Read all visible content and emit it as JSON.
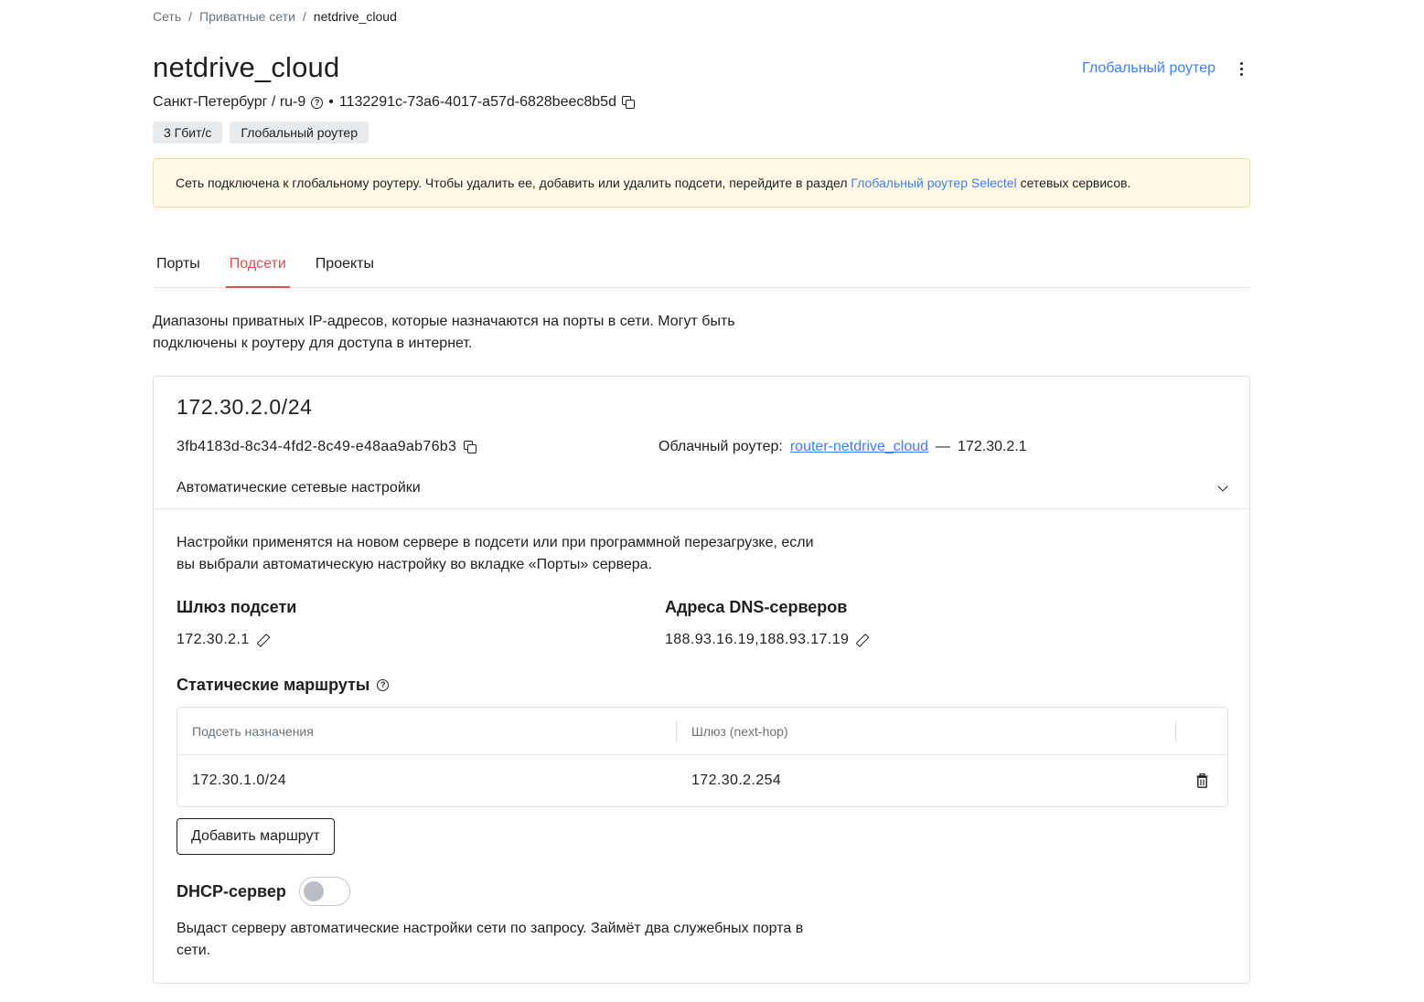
{
  "breadcrumb": {
    "items": [
      "Сеть",
      "Приватные сети"
    ],
    "separator": "/",
    "current": "netdrive_cloud"
  },
  "header": {
    "title": "netdrive_cloud",
    "location": "Санкт-Петербург / ru-9",
    "bullet": "•",
    "network_id": "1132291c-73a6-4017-a57d-6828beec8b5d",
    "global_router_link": "Глобальный роутер",
    "tags": [
      "3 Гбит/с",
      "Глобальный роутер"
    ]
  },
  "alert": {
    "text_before": "Сеть подключена к глобальному роутеру. Чтобы удалить ее, добавить или удалить подсети, перейдите в раздел",
    "link": "Глобальный роутер Selectel",
    "text_after": "сетевых сервисов."
  },
  "tabs": [
    {
      "label": "Порты",
      "active": false
    },
    {
      "label": "Подсети",
      "active": true
    },
    {
      "label": "Проекты",
      "active": false
    }
  ],
  "subnets": {
    "description": "Диапазоны приватных IP-адресов, которые назначаются на порты в сети. Могут быть подключены к роутеру для доступа в интернет."
  },
  "subnet": {
    "cidr": "172.30.2.0/24",
    "uuid": "3fb4183d-8c34-4fd2-8c49-e48aa9ab76b3",
    "router_label": "Облачный роутер:",
    "router_link": "router-netdrive_cloud",
    "router_dash": "—",
    "router_ip": "172.30.2.1",
    "accordion_title": "Автоматические сетевые настройки",
    "accordion_desc": "Настройки применятся на новом сервере в подсети или при программной перезагрузке, если вы выбрали автоматическую настройку во вкладке «Порты» сервера.",
    "gateway_label": "Шлюз подсети",
    "gateway_value": "172.30.2.1",
    "dns_label": "Адреса DNS-серверов",
    "dns_value": "188.93.16.19,188.93.17.19",
    "routes_title": "Статические маршруты",
    "routes_table": {
      "headers": [
        "Подсеть назначения",
        "Шлюз (next-hop)"
      ],
      "rows": [
        {
          "destination": "172.30.1.0/24",
          "next_hop": "172.30.2.254"
        }
      ]
    },
    "add_route_button": "Добавить маршрут",
    "dhcp_label": "DHCP-сервер",
    "dhcp_enabled": false,
    "dhcp_desc": "Выдаст серверу автоматические настройки сети по запросу. Займёт два служебных порта в сети."
  },
  "colors": {
    "accent_link": "#3b82f6",
    "tab_active": "#e0504d",
    "alert_bg": "#fff9e6",
    "alert_border": "#f3dc9a",
    "tag_bg": "#e8ebee"
  },
  "icons": {
    "help": "question-circle-icon",
    "copy": "copy-icon",
    "edit": "pencil-icon",
    "delete": "trash-icon",
    "expand": "chevron-down-icon",
    "menu": "kebab-menu-icon"
  }
}
